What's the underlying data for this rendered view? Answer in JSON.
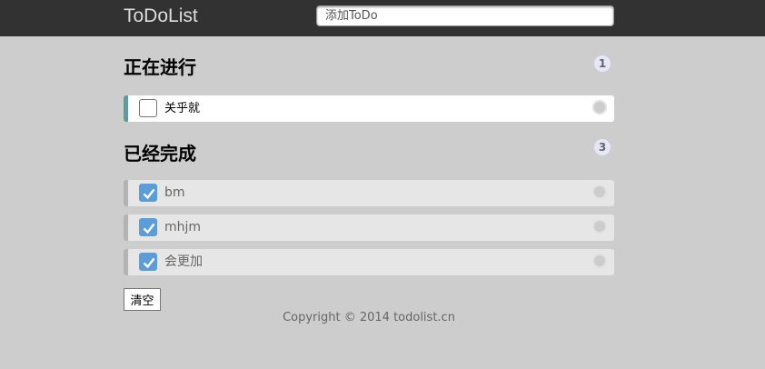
{
  "header": {
    "title": "ToDoList",
    "add_placeholder": "添加ToDo"
  },
  "sections": {
    "doing": {
      "title": "正在进行",
      "count": "1",
      "items": [
        {
          "text": "关乎就",
          "checked": false
        }
      ]
    },
    "done": {
      "title": "已经完成",
      "count": "3",
      "items": [
        {
          "text": "bm",
          "checked": true
        },
        {
          "text": "mhjm",
          "checked": true
        },
        {
          "text": "会更加",
          "checked": true
        }
      ]
    }
  },
  "clear_label": "清空",
  "footer": "Copyright © 2014 todolist.cn",
  "colors": {
    "header_bg": "#323232",
    "page_bg": "#cdcdcd",
    "doing_accent": "#629a9c",
    "done_accent": "#b3b3b3",
    "checkbox_checked": "#5b9dd9"
  }
}
